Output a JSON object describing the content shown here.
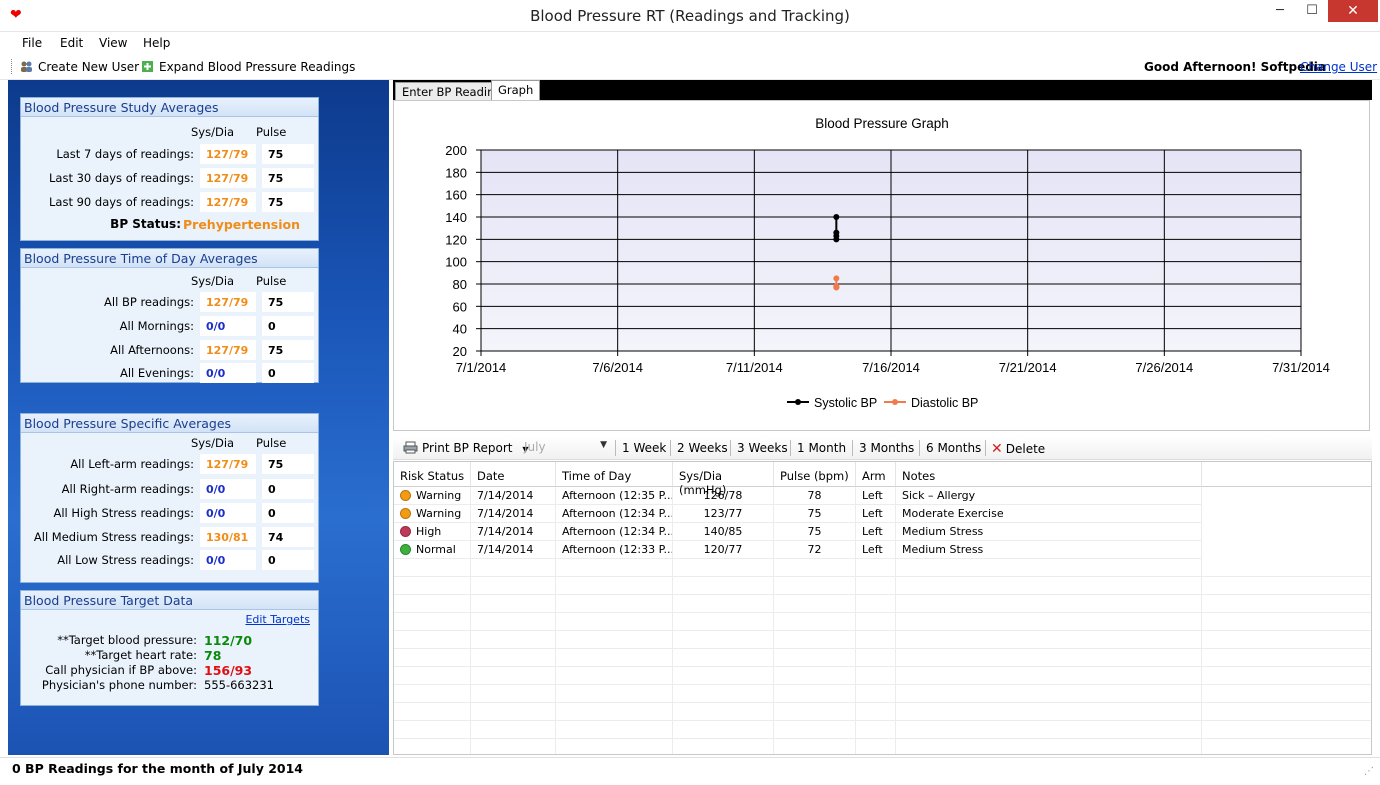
{
  "window": {
    "title": "Blood Pressure RT (Readings and Tracking)",
    "minimize": "─",
    "maximize": "☐",
    "close": "✕"
  },
  "menu": [
    "File",
    "Edit",
    "View",
    "Help"
  ],
  "toolbar": {
    "create_user": "Create New User",
    "expand_readings": "Expand Blood Pressure Readings",
    "greeting": "Good Afternoon! Softpedia",
    "change_user": "Change User"
  },
  "study": {
    "title": "Blood Pressure Study Averages",
    "col_sysdia": "Sys/Dia",
    "col_pulse": "Pulse",
    "rows": [
      {
        "label": "Last 7 days of readings:",
        "sysdia": "127/79",
        "pulse": "75"
      },
      {
        "label": "Last 30 days of readings:",
        "sysdia": "127/79",
        "pulse": "75"
      },
      {
        "label": "Last 90 days of readings:",
        "sysdia": "127/79",
        "pulse": "75"
      }
    ],
    "status_label": "BP Status:",
    "status_value": "Prehypertension"
  },
  "timeofday": {
    "title": "Blood Pressure Time of Day Averages",
    "col_sysdia": "Sys/Dia",
    "col_pulse": "Pulse",
    "rows": [
      {
        "label": "All BP readings:",
        "sysdia": "127/79",
        "pulse": "75"
      },
      {
        "label": "All Mornings:",
        "sysdia": "0/0",
        "pulse": "0"
      },
      {
        "label": "All Afternoons:",
        "sysdia": "127/79",
        "pulse": "75"
      },
      {
        "label": "All Evenings:",
        "sysdia": "0/0",
        "pulse": "0"
      }
    ]
  },
  "specific": {
    "title": "Blood Pressure Specific Averages",
    "col_sysdia": "Sys/Dia",
    "col_pulse": "Pulse",
    "rows": [
      {
        "label": "All Left-arm readings:",
        "sysdia": "127/79",
        "pulse": "75"
      },
      {
        "label": "All Right-arm readings:",
        "sysdia": "0/0",
        "pulse": "0"
      },
      {
        "label": "All High Stress readings:",
        "sysdia": "0/0",
        "pulse": "0"
      },
      {
        "label": "All Medium Stress readings:",
        "sysdia": "130/81",
        "pulse": "74"
      },
      {
        "label": "All Low Stress readings:",
        "sysdia": "0/0",
        "pulse": "0"
      }
    ]
  },
  "target": {
    "title": "Blood Pressure Target Data",
    "edit": "Edit Targets",
    "rows": [
      {
        "label": "**Target blood pressure:",
        "value": "112/70"
      },
      {
        "label": "**Target heart rate:",
        "value": "78"
      },
      {
        "label": "Call physician if BP above:",
        "value": "156/93"
      },
      {
        "label": "Physician's phone number:",
        "value": "555-663231"
      }
    ]
  },
  "tabs": [
    "Enter BP Reading",
    "Graph"
  ],
  "chart_data": {
    "type": "line",
    "title": "Blood Pressure Graph",
    "x_ticks": [
      "7/1/2014",
      "7/6/2014",
      "7/11/2014",
      "7/16/2014",
      "7/21/2014",
      "7/26/2014",
      "7/31/2014"
    ],
    "xlim": [
      "7/1/2014",
      "7/31/2014"
    ],
    "ylim": [
      20,
      200
    ],
    "y_ticks": [
      20,
      40,
      60,
      80,
      100,
      120,
      140,
      160,
      180,
      200
    ],
    "grid": true,
    "legend_position": "bottom-center",
    "series": [
      {
        "name": "Systolic BP",
        "color": "#000000",
        "points": [
          [
            "7/14/2014",
            126
          ],
          [
            "7/14/2014",
            123
          ],
          [
            "7/14/2014",
            140
          ],
          [
            "7/14/2014",
            120
          ]
        ]
      },
      {
        "name": "Diastolic BP",
        "color": "#f07a4a",
        "points": [
          [
            "7/14/2014",
            78
          ],
          [
            "7/14/2014",
            77
          ],
          [
            "7/14/2014",
            85
          ],
          [
            "7/14/2014",
            77
          ]
        ]
      }
    ]
  },
  "report_toolbar": {
    "print": "Print BP Report",
    "month": "July",
    "ranges": [
      "1 Week",
      "2 Weeks",
      "3 Weeks",
      "1 Month",
      "3 Months",
      "6 Months"
    ],
    "delete": "Delete"
  },
  "table": {
    "headers": [
      "Risk Status",
      "Date",
      "Time of Day",
      "Sys/Dia (mmHg)",
      "Pulse (bpm)",
      "Arm",
      "Notes"
    ],
    "rows": [
      {
        "risk": "Warning",
        "risk_color": "#f39c12",
        "date": "7/14/2014",
        "time": "Afternoon (12:35 P...",
        "sysdia": "126/78",
        "pulse": "78",
        "arm": "Left",
        "notes": "Sick – Allergy"
      },
      {
        "risk": "Warning",
        "risk_color": "#f39c12",
        "date": "7/14/2014",
        "time": "Afternoon (12:34 P...",
        "sysdia": "123/77",
        "pulse": "75",
        "arm": "Left",
        "notes": "Moderate Exercise"
      },
      {
        "risk": "High",
        "risk_color": "#c0395a",
        "date": "7/14/2014",
        "time": "Afternoon (12:34 P...",
        "sysdia": "140/85",
        "pulse": "75",
        "arm": "Left",
        "notes": "Medium Stress"
      },
      {
        "risk": "Normal",
        "risk_color": "#3cb23c",
        "date": "7/14/2014",
        "time": "Afternoon (12:33 P...",
        "sysdia": "120/77",
        "pulse": "72",
        "arm": "Left",
        "notes": "Medium Stress"
      }
    ]
  },
  "status_bar": "0 BP Readings for the month of July 2014"
}
